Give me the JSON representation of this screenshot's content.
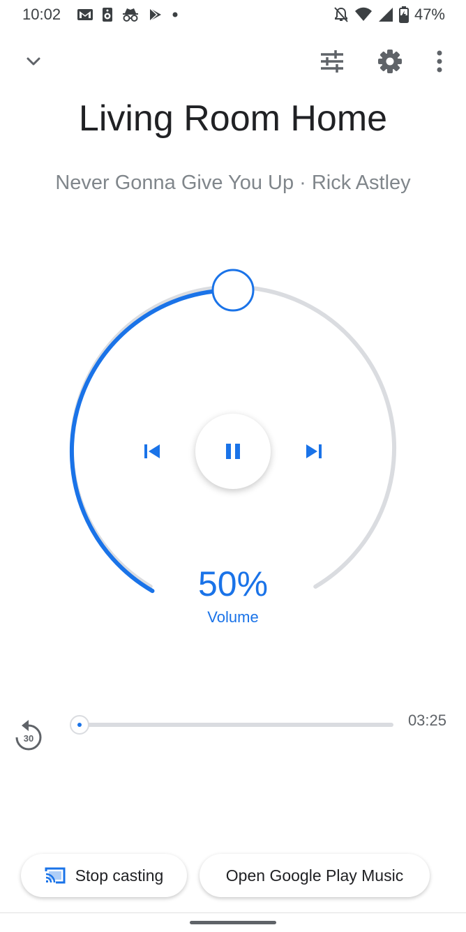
{
  "status_bar": {
    "time": "10:02",
    "battery": "47%",
    "icons_left": [
      "gmail-icon",
      "speaker-icon",
      "incognito-icon",
      "play-store-icon",
      "dot-icon"
    ],
    "icons_right": [
      "notifications-off-icon",
      "wifi-icon",
      "cellular-icon",
      "battery-charging-icon"
    ]
  },
  "top_bar": {
    "icons": [
      "chevron-down-icon",
      "equalizer-icon",
      "gear-icon",
      "more-vert-icon"
    ]
  },
  "device": {
    "title": "Living Room Home",
    "now_playing": "Never Gonna Give You Up · Rick Astley"
  },
  "volume": {
    "value": "50%",
    "label": "Volume",
    "level": 0.5
  },
  "playback": {
    "controls": [
      "previous-icon",
      "pause-icon",
      "next-icon"
    ],
    "duration": "03:25",
    "progress": 0,
    "replay_seconds": "30"
  },
  "actions": {
    "stop_casting": "Stop casting",
    "open_app": "Open Google Play Music"
  },
  "colors": {
    "accent": "#1a73e8",
    "track": "#dadce0",
    "text_secondary": "#80868b"
  }
}
